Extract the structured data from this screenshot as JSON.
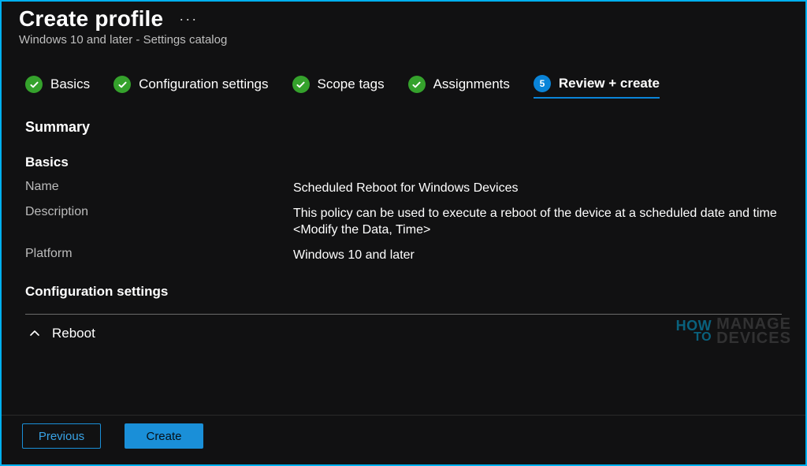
{
  "header": {
    "title": "Create profile",
    "more": "···",
    "subtitle": "Windows 10 and later - Settings catalog"
  },
  "steps": [
    {
      "label": "Basics",
      "state": "done"
    },
    {
      "label": "Configuration settings",
      "state": "done"
    },
    {
      "label": "Scope tags",
      "state": "done"
    },
    {
      "label": "Assignments",
      "state": "done"
    },
    {
      "label": "Review + create",
      "state": "current",
      "number": "5"
    }
  ],
  "summary_heading": "Summary",
  "basics": {
    "heading": "Basics",
    "rows": {
      "name_label": "Name",
      "name_value": "Scheduled Reboot for Windows Devices",
      "description_label": "Description",
      "description_value": "This policy can be used to execute a reboot of the device at a scheduled date and time <Modify the Data, Time>",
      "platform_label": "Platform",
      "platform_value": "Windows 10 and later"
    }
  },
  "config": {
    "heading": "Configuration settings",
    "accordion_label": "Reboot"
  },
  "footer": {
    "previous": "Previous",
    "create": "Create"
  },
  "watermark": {
    "how": "HOW",
    "to": "TO",
    "line1": "MANAGE",
    "line2": "DEVICES"
  }
}
